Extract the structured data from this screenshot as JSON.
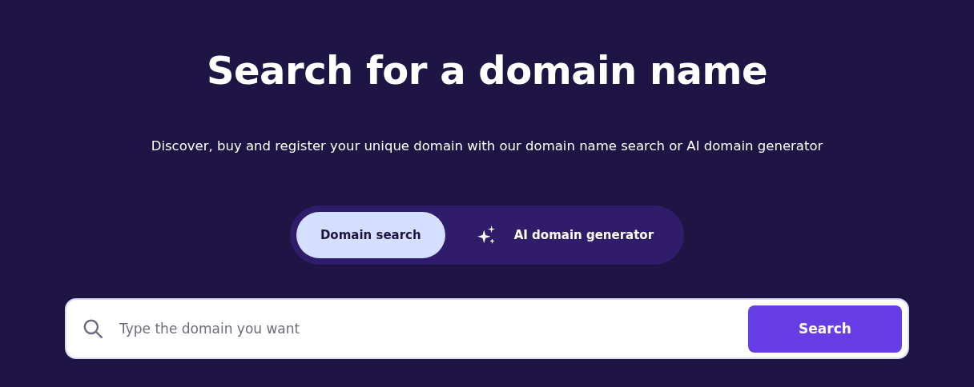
{
  "title": "Search for a domain name",
  "subtitle": "Discover, buy and register your unique domain with our domain name search or AI domain generator",
  "tabs": [
    {
      "label": "Domain search",
      "selected": true,
      "kind": "plain"
    },
    {
      "label": "AI domain generator",
      "selected": false,
      "kind": "sparkle"
    }
  ],
  "search": {
    "placeholder": "Type the domain you want",
    "button": "Search"
  }
}
